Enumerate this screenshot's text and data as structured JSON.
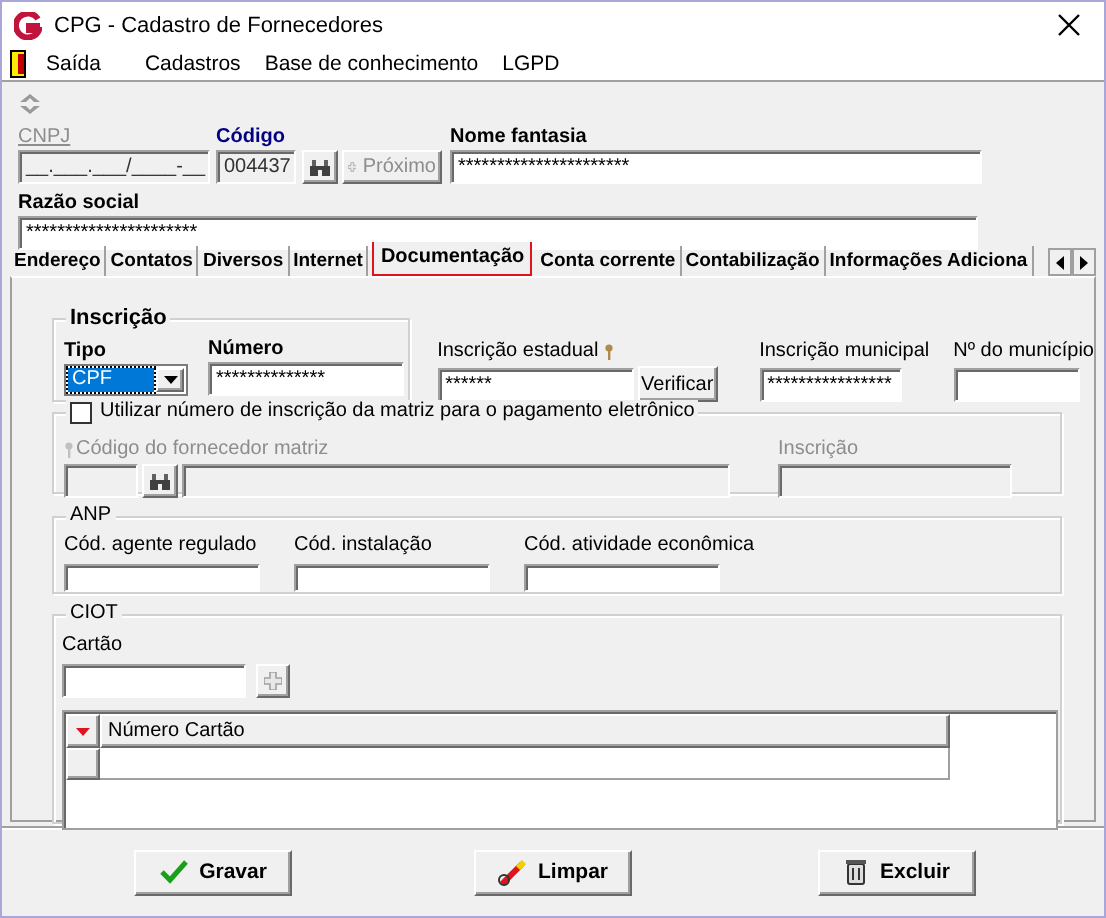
{
  "window": {
    "title": "CPG - Cadastro de Fornecedores"
  },
  "menu": {
    "exit": "Saída",
    "items": [
      "Cadastros",
      "Base de conhecimento",
      "LGPD"
    ]
  },
  "header": {
    "cnpj": {
      "label": "CNPJ",
      "value": "__.___.___/____-__",
      "disabled": true
    },
    "codigo": {
      "label": "Código",
      "value": "004437"
    },
    "next_button": {
      "label": "Próximo",
      "disabled": true
    },
    "nome_fantasia": {
      "label": "Nome fantasia",
      "value": "**********************"
    },
    "razao_social": {
      "label": "Razão social",
      "value": "**********************"
    }
  },
  "tabs": [
    {
      "label": "Endereço",
      "selected": false
    },
    {
      "label": "Contatos",
      "selected": false
    },
    {
      "label": "Diversos",
      "selected": false
    },
    {
      "label": "Internet",
      "selected": false
    },
    {
      "label": "Documentação",
      "selected": true
    },
    {
      "label": "Conta corrente",
      "selected": false
    },
    {
      "label": "Contabilização",
      "selected": false
    },
    {
      "label": "Informações Adiciona",
      "selected": false
    }
  ],
  "inscricao": {
    "title": "Inscrição",
    "tipo_label": "Tipo",
    "tipo_value": "CPF",
    "numero_label": "Número",
    "numero_value": "**************"
  },
  "inscricao_estadual": {
    "label": "Inscrição estadual",
    "value": "******",
    "button": "Verificar"
  },
  "inscricao_municipal": {
    "label": "Inscrição municipal",
    "value": "****************"
  },
  "numero_municipio": {
    "label": "Nº do município"
  },
  "matriz": {
    "checkbox_label": "Utilizar número de inscrição da matriz para o pagamento eletrônico",
    "checked": false,
    "codigo_label": "Código do fornecedor matriz",
    "inscricao_label": "Inscrição",
    "disabled": true
  },
  "anp": {
    "title": "ANP",
    "fields": [
      "Cód. agente regulado",
      "Cód. instalação",
      "Cód. atividade econômica"
    ]
  },
  "ciot": {
    "title": "CIOT",
    "cartao_label": "Cartão",
    "add_disabled": true,
    "grid_columns": [
      "Número Cartão"
    ]
  },
  "buttons": [
    {
      "label": "Gravar",
      "kind": "save"
    },
    {
      "label": "Limpar",
      "kind": "clear"
    },
    {
      "label": "Excluir",
      "kind": "delete"
    }
  ]
}
